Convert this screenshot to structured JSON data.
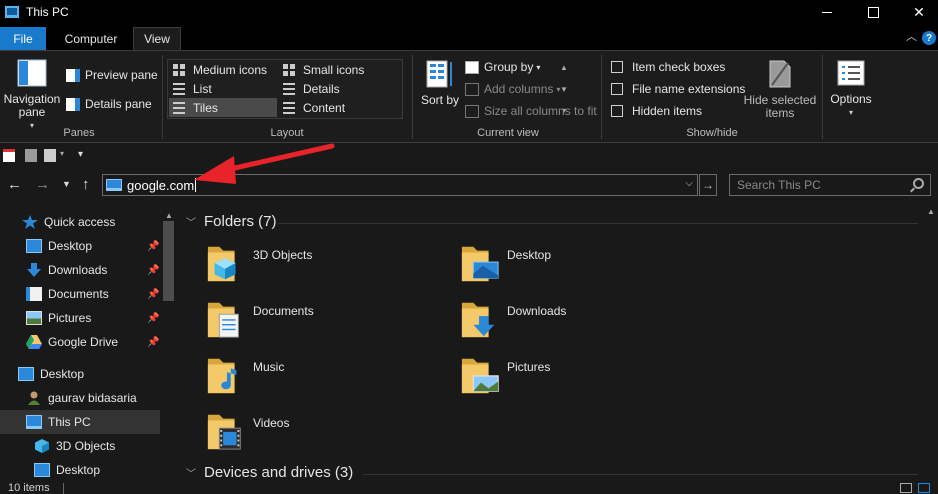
{
  "window": {
    "title": "This PC",
    "controls": {
      "minimize": "–",
      "maximize": "□",
      "close": "✕"
    }
  },
  "ribbon_tabs": {
    "file": "File",
    "computer": "Computer",
    "view": "View"
  },
  "ribbon": {
    "panes": {
      "navigation_pane": "Navigation pane",
      "preview_pane": "Preview pane",
      "details_pane": "Details pane",
      "group_label": "Panes"
    },
    "layout": {
      "items": [
        "Medium icons",
        "Small icons",
        "List",
        "Details",
        "Tiles",
        "Content"
      ],
      "selected": "Tiles",
      "group_label": "Layout"
    },
    "current_view": {
      "sort_by": "Sort by",
      "group_by": "Group by",
      "add_columns": "Add columns",
      "size_all_columns": "Size all columns to fit",
      "group_label": "Current view"
    },
    "show_hide": {
      "item_check_boxes": "Item check boxes",
      "file_name_extensions": "File name extensions",
      "hidden_items": "Hidden items",
      "hide_selected_items": "Hide selected items",
      "group_label": "Show/hide"
    },
    "options": "Options"
  },
  "address": {
    "value": "google.com",
    "search_placeholder": "Search This PC"
  },
  "nav_pane": {
    "items": [
      {
        "label": "Quick access",
        "icon": "star-icon"
      },
      {
        "label": "Desktop",
        "icon": "desktop-folder-icon",
        "pinned": true
      },
      {
        "label": "Downloads",
        "icon": "download-arrow-icon",
        "pinned": true
      },
      {
        "label": "Documents",
        "icon": "documents-icon",
        "pinned": true
      },
      {
        "label": "Pictures",
        "icon": "pictures-icon",
        "pinned": true
      },
      {
        "label": "Google Drive",
        "icon": "google-drive-icon",
        "pinned": true
      },
      {
        "label": "Desktop",
        "icon": "desktop-icon"
      },
      {
        "label": "gaurav bidasaria",
        "icon": "user-icon"
      },
      {
        "label": "This PC",
        "icon": "this-pc-icon",
        "selected": true
      },
      {
        "label": "3D Objects",
        "icon": "3d-objects-icon"
      },
      {
        "label": "Desktop",
        "icon": "desktop-folder-icon"
      }
    ]
  },
  "content": {
    "folders_header": "Folders (7)",
    "folders": [
      {
        "name": "3D Objects",
        "overlay": "cube"
      },
      {
        "name": "Desktop",
        "overlay": "screen"
      },
      {
        "name": "Documents",
        "overlay": "doc"
      },
      {
        "name": "Downloads",
        "overlay": "arrow"
      },
      {
        "name": "Music",
        "overlay": "note"
      },
      {
        "name": "Pictures",
        "overlay": "photo"
      },
      {
        "name": "Videos",
        "overlay": "film"
      }
    ],
    "devices_header": "Devices and drives (3)"
  },
  "status": {
    "items_count": "10 items"
  },
  "colors": {
    "accent": "#1979ca",
    "annotation_arrow": "#e8242a",
    "folder_yellow": "#f3c969"
  }
}
